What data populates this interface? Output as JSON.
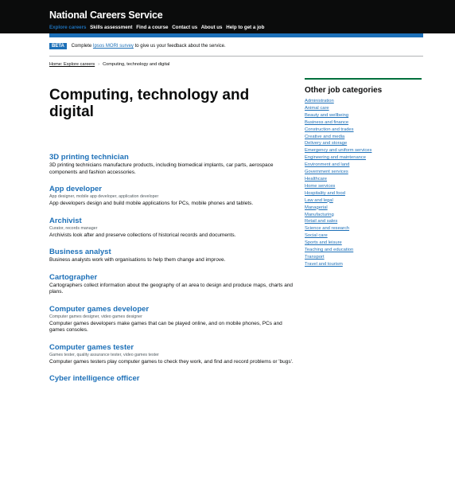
{
  "header": {
    "brand": "National Careers Service",
    "nav": [
      {
        "label": "Explore careers",
        "active": true
      },
      {
        "label": "Skills assessment",
        "active": false
      },
      {
        "label": "Find a course",
        "active": false
      },
      {
        "label": "Contact us",
        "active": false
      },
      {
        "label": "About us",
        "active": false
      },
      {
        "label": "Help to get a job",
        "active": false
      }
    ]
  },
  "phase": {
    "tag": "BETA",
    "text_before": "Complete",
    "link": "Ipsos MORI survey",
    "text_after": "to give us your feedback about the service."
  },
  "breadcrumb": {
    "link": "Home: Explore careers",
    "current": "Computing, technology and digital"
  },
  "page": {
    "title": "Computing, technology and digital"
  },
  "results": [
    {
      "title": "3D printing technician",
      "alt": "",
      "desc": "3D printing technicians manufacture products, including biomedical implants, car parts, aerospace components and fashion accessories."
    },
    {
      "title": "App developer",
      "alt": "App designer, mobile app developer, application developer",
      "desc": "App developers design and build mobile applications for PCs, mobile phones and tablets."
    },
    {
      "title": "Archivist",
      "alt": "Curator, records manager",
      "desc": "Archivists look after and preserve collections of historical records and documents."
    },
    {
      "title": "Business analyst",
      "alt": "",
      "desc": "Business analysts work with organisations to help them change and improve."
    },
    {
      "title": "Cartographer",
      "alt": "",
      "desc": "Cartographers collect information about the geography of an area to design and produce maps, charts and plans."
    },
    {
      "title": "Computer games developer",
      "alt": "Computer games designer, video games designer",
      "desc": "Computer games developers make games that can be played online, and on mobile phones, PCs and games consoles."
    },
    {
      "title": "Computer games tester",
      "alt": "Games tester, quality assurance tester, video games tester",
      "desc": "Computer games testers play computer games to check they work, and find and record problems or 'bugs'."
    },
    {
      "title": "Cyber intelligence officer",
      "alt": "",
      "desc": ""
    }
  ],
  "sidebar": {
    "heading": "Other job categories",
    "items": [
      "Administration",
      "Animal care",
      "Beauty and wellbeing",
      "Business and finance",
      "Construction and trades",
      "Creative and media",
      "Delivery and storage",
      "Emergency and uniform services",
      "Engineering and maintenance",
      "Environment and land",
      "Government services",
      "Healthcare",
      "Home services",
      "Hospitality and food",
      "Law and legal",
      "Managerial",
      "Manufacturing",
      "Retail and sales",
      "Science and research",
      "Social care",
      "Sports and leisure",
      "Teaching and education",
      "Transport",
      "Travel and tourism"
    ]
  },
  "colors": {
    "header_bg": "#0b0c0c",
    "link": "#1d70b8",
    "accent_green": "#00703c"
  }
}
